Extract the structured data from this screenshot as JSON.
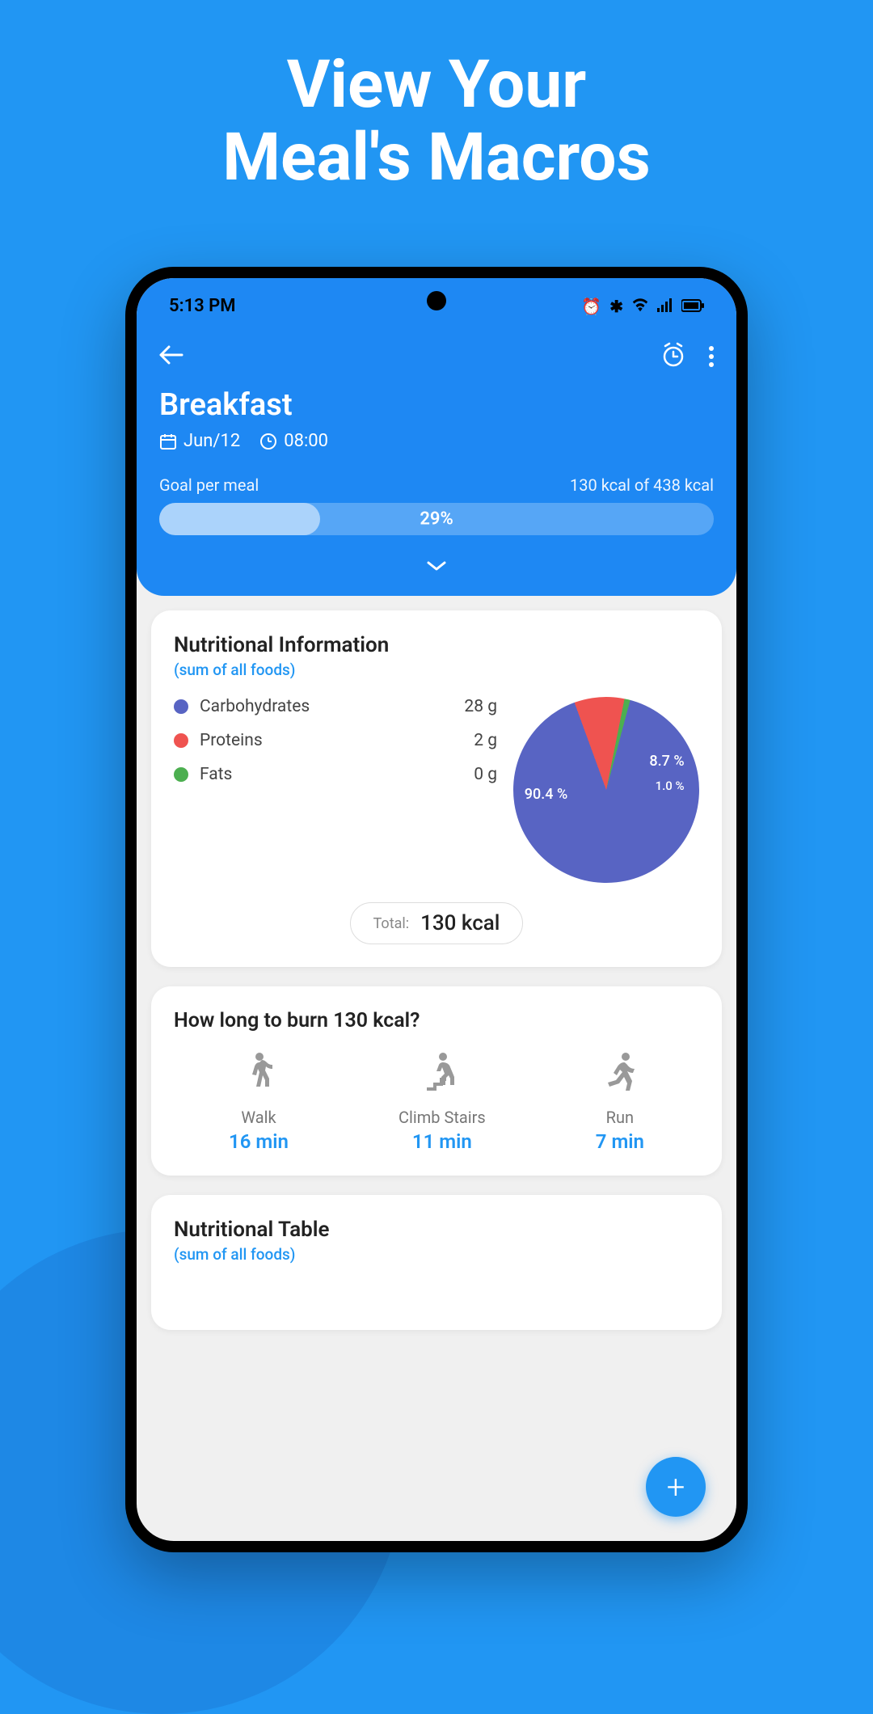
{
  "promo": {
    "title_line1": "View Your",
    "title_line2": "Meal's Macros"
  },
  "status": {
    "time": "5:13 PM"
  },
  "header": {
    "title": "Breakfast",
    "date": "Jun/12",
    "time": "08:00",
    "goal_label": "Goal per meal",
    "goal_status": "130 kcal of 438 kcal",
    "progress_pct": "29%",
    "progress_width": 29
  },
  "nutrition": {
    "title": "Nutritional Information",
    "subtitle": "(sum of all foods)",
    "items": [
      {
        "name": "Carbohydrates",
        "value": "28 g",
        "color": "#5864c3"
      },
      {
        "name": "Proteins",
        "value": "2 g",
        "color": "#ef5350"
      },
      {
        "name": "Fats",
        "value": "0 g",
        "color": "#4caf50"
      }
    ],
    "pie_labels": {
      "main": "90.4 %",
      "second": "8.7 %",
      "third": "1.0 %"
    },
    "total_label": "Total:",
    "total_value": "130 kcal"
  },
  "chart_data": {
    "type": "pie",
    "title": "Macronutrient breakdown",
    "series": [
      {
        "name": "Carbohydrates",
        "value": 90.4,
        "color": "#5864c3"
      },
      {
        "name": "Proteins",
        "value": 8.7,
        "color": "#ef5350"
      },
      {
        "name": "Fats",
        "value": 1.0,
        "color": "#4caf50"
      }
    ]
  },
  "burn": {
    "title": "How long to burn 130 kcal?",
    "activities": [
      {
        "name": "Walk",
        "time": "16 min",
        "icon": "🚶"
      },
      {
        "name": "Climb Stairs",
        "time": "11 min",
        "icon": "🧗"
      },
      {
        "name": "Run",
        "time": "7 min",
        "icon": "🏃"
      }
    ]
  },
  "table": {
    "title": "Nutritional Table",
    "subtitle": "(sum of all foods)"
  }
}
